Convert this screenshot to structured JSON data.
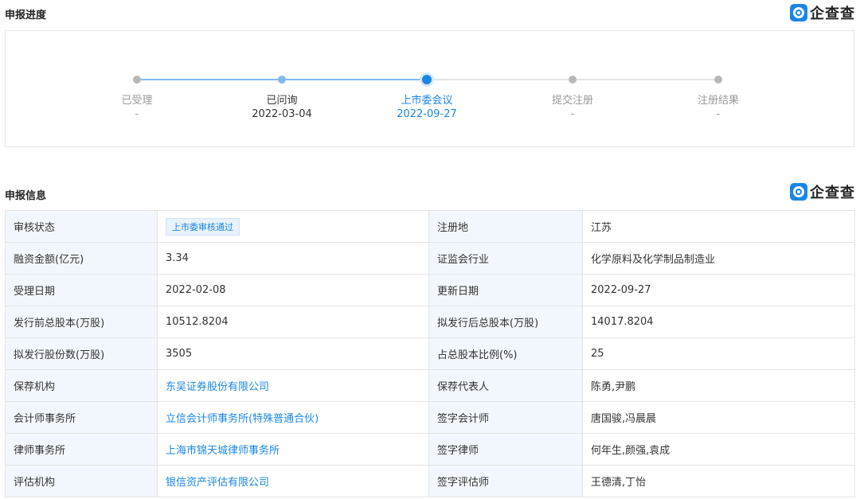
{
  "progress": {
    "title": "申报进度",
    "steps": [
      {
        "label": "已受理",
        "value": "-"
      },
      {
        "label": "已问询",
        "value": "2022-03-04"
      },
      {
        "label": "上市委会议",
        "value": "2022-09-27"
      },
      {
        "label": "提交注册",
        "value": "-"
      },
      {
        "label": "注册结果",
        "value": "-"
      }
    ]
  },
  "info": {
    "title": "申报信息",
    "rows": [
      {
        "k1": "审核状态",
        "v1": "上市委审核通过",
        "k2": "注册地",
        "v2": "江苏"
      },
      {
        "k1": "融资金额(亿元)",
        "v1": "3.34",
        "k2": "证监会行业",
        "v2": "化学原料及化学制品制造业"
      },
      {
        "k1": "受理日期",
        "v1": "2022-02-08",
        "k2": "更新日期",
        "v2": "2022-09-27"
      },
      {
        "k1": "发行前总股本(万股)",
        "v1": "10512.8204",
        "k2": "拟发行后总股本(万股)",
        "v2": "14017.8204"
      },
      {
        "k1": "拟发行股份数(万股)",
        "v1": "3505",
        "k2": "占总股本比例(%)",
        "v2": "25"
      },
      {
        "k1": "保荐机构",
        "v1": "东吴证券股份有限公司",
        "k2": "保荐代表人",
        "v2": "陈勇,尹鹏"
      },
      {
        "k1": "会计师事务所",
        "v1": "立信会计师事务所(特殊普通合伙)",
        "k2": "签字会计师",
        "v2": "唐国骏,冯晨晨"
      },
      {
        "k1": "律师事务所",
        "v1": "上海市锦天城律师事务所",
        "k2": "签字律师",
        "v2": "何年生,颜强,袁成"
      },
      {
        "k1": "评估机构",
        "v1": "银信资产评估有限公司",
        "k2": "签字评估师",
        "v2": "王德清,丁怡"
      }
    ]
  },
  "logo": {
    "text": "企查查",
    "icon": "qichacha-logo-icon"
  },
  "colors": {
    "accent": "#1a86e6",
    "done_dot": "#7fb9ef",
    "pending_dot": "#b8b8b8",
    "key_bg": "#f2f7fd"
  }
}
